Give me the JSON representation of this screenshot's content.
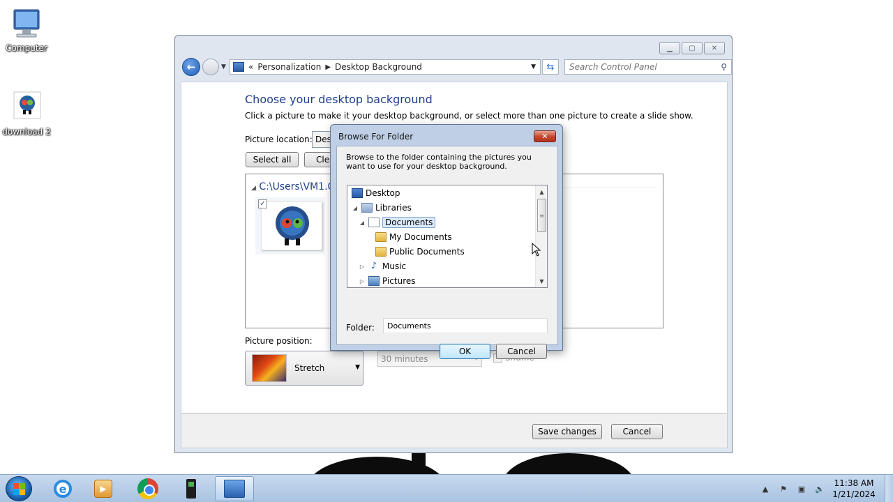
{
  "desktop": {
    "icons": [
      {
        "label": "Computer"
      },
      {
        "label": "download 2"
      }
    ]
  },
  "window": {
    "breadcrumb": {
      "root_marker": "«",
      "items": [
        "Personalization",
        "Desktop Background"
      ]
    },
    "search_placeholder": "Search Control Panel",
    "title": "Choose your desktop background",
    "subtitle": "Click a picture to make it your desktop background, or select more than one picture to create a slide show.",
    "picture_location_label": "Picture location:",
    "picture_location_value": "Desk",
    "select_all_label": "Select all",
    "clear_all_label": "Clea",
    "group_heading": "C:\\Users\\VM1.C",
    "picture_position_label": "Picture position:",
    "picture_position_value": "Stretch",
    "interval_value": "30 minutes",
    "shuffle_label": "Shuffle",
    "save_label": "Save changes",
    "cancel_label": "Cancel"
  },
  "dialog": {
    "title": "Browse For Folder",
    "instructions": "Browse to the folder containing the pictures you want to use for your desktop background.",
    "tree": [
      {
        "label": "Desktop",
        "icon": "desktop-icon",
        "twisty": ""
      },
      {
        "label": "Libraries",
        "icon": "libraries-icon",
        "twisty": "◢"
      },
      {
        "label": "Documents",
        "icon": "document-library-icon",
        "twisty": "◢",
        "selected": true
      },
      {
        "label": "My Documents",
        "icon": "folder-icon",
        "twisty": ""
      },
      {
        "label": "Public Documents",
        "icon": "folder-icon",
        "twisty": ""
      },
      {
        "label": "Music",
        "icon": "music-icon",
        "twisty": "▷"
      },
      {
        "label": "Pictures",
        "icon": "pictures-icon",
        "twisty": "▷"
      }
    ],
    "folder_label": "Folder:",
    "folder_value": "Documents",
    "ok_label": "OK",
    "cancel_label": "Cancel"
  },
  "taskbar": {
    "clock_time": "11:38 AM",
    "clock_date": "1/21/2024"
  }
}
